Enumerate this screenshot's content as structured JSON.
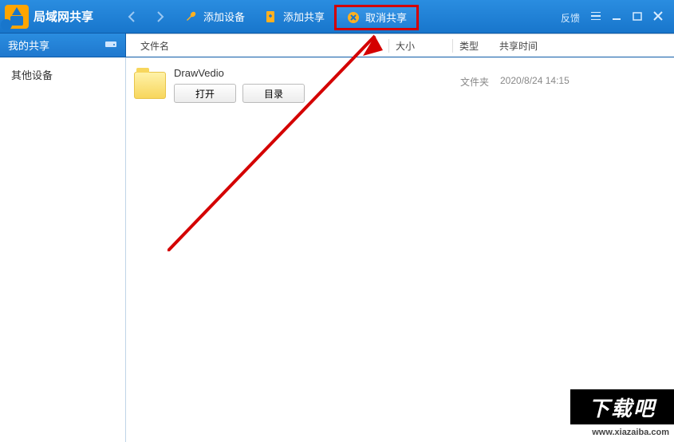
{
  "app": {
    "title": "局域网共享",
    "feedback": "反馈"
  },
  "toolbar": {
    "add_device": "添加设备",
    "add_share": "添加共享",
    "cancel_share": "取消共享"
  },
  "sidebar": {
    "tab_label": "我的共享",
    "items": [
      {
        "label": "其他设备"
      }
    ]
  },
  "columns": {
    "name": "文件名",
    "size": "大小",
    "type": "类型",
    "time": "共享时间"
  },
  "files": [
    {
      "name": "DrawVedio",
      "type": "文件夹",
      "time": "2020/8/24 14:15",
      "actions": {
        "open": "打开",
        "dir": "目录"
      }
    }
  ],
  "watermark": {
    "logo_text": "下载吧",
    "url": "www.xiazaiba.com"
  }
}
